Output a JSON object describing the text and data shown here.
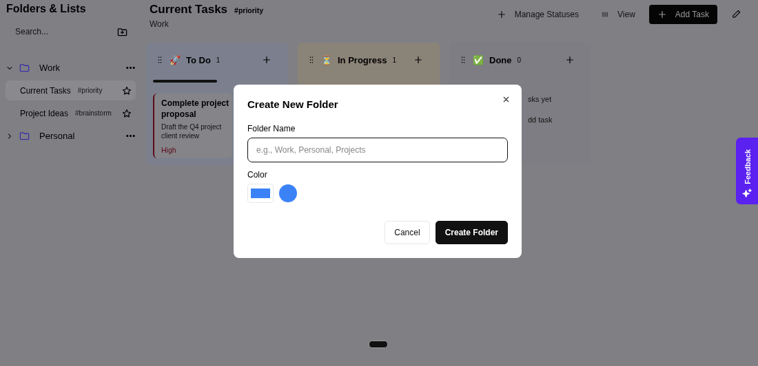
{
  "sidebar": {
    "title": "Folders & Lists",
    "search": {
      "placeholder": "Search..."
    },
    "folders": [
      {
        "name": "Work",
        "expanded": true,
        "color": "#3a32a8",
        "children": [
          {
            "name": "Current Tasks",
            "tag": "#priority",
            "selected": true
          },
          {
            "name": "Project Ideas",
            "tag": "#brainstorm",
            "selected": false
          }
        ]
      },
      {
        "name": "Personal",
        "expanded": false,
        "color": "#3a32a8"
      }
    ]
  },
  "header": {
    "title": "Current Tasks",
    "tag": "#priority",
    "subtitle": "Work",
    "actions": [
      {
        "kind": "plain",
        "label": "Manage Statuses"
      },
      {
        "kind": "plain",
        "label": "View"
      },
      {
        "kind": "primary",
        "label": "Add Task"
      },
      {
        "kind": "icon"
      }
    ]
  },
  "columns": [
    {
      "emoji": "🚀",
      "name": "To Do",
      "count": "1",
      "color": "#7c808e",
      "tasks": [
        {
          "title": "Complete project proposal",
          "description": "Draft the Q4 project client review",
          "priority": "High",
          "color": "#5c0a16"
        }
      ]
    },
    {
      "emoji": "⏳",
      "name": "In Progress",
      "count": "1",
      "color": "#8a8378"
    },
    {
      "emoji": "✅",
      "name": "Done",
      "count": "0",
      "color": "#7e7d83",
      "empty_text": "sks yet",
      "add_text": "dd task"
    }
  ],
  "dialog": {
    "title": "Create New Folder",
    "name_label": "Folder Name",
    "name_field": {
      "placeholder": "e.g., Work, Personal, Projects"
    },
    "color_label": "Color",
    "color_options": [
      {
        "kind": "picker",
        "color": "#3b82f6"
      },
      {
        "kind": "swatch",
        "color": "#3b82f6"
      }
    ],
    "buttons": [
      {
        "kind": "secondary",
        "label": "Cancel"
      },
      {
        "kind": "primary",
        "label": "Create Folder"
      }
    ]
  },
  "feedback": {
    "label": "Feedback"
  }
}
